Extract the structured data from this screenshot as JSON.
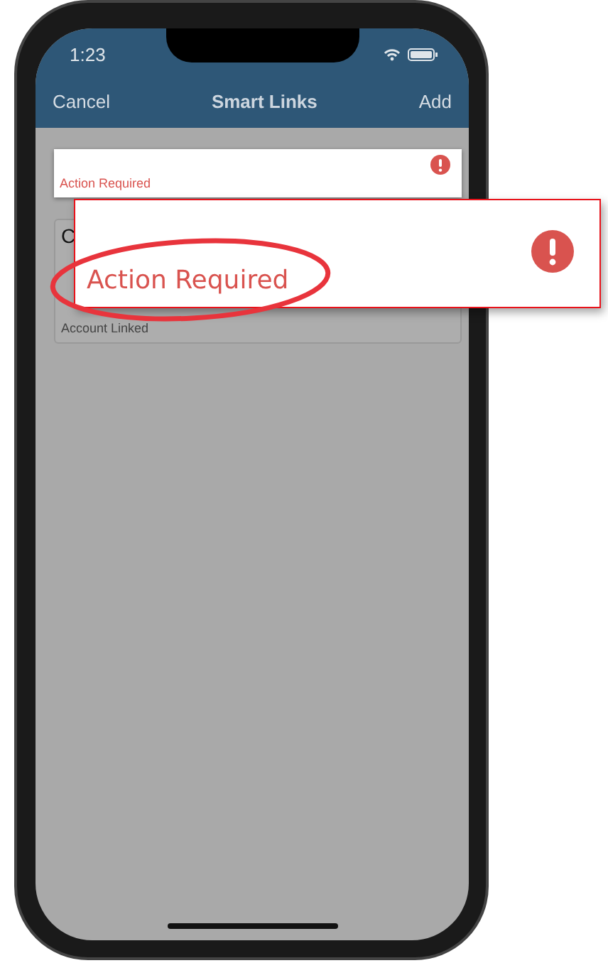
{
  "status_bar": {
    "time": "1:23"
  },
  "nav": {
    "left": "Cancel",
    "title": "Smart Links",
    "right": "Add"
  },
  "cards": [
    {
      "kind": "alert",
      "subtitle": "Action Required"
    },
    {
      "kind": "partial",
      "title": "C"
    },
    {
      "kind": "linked",
      "subtitle": "Account Linked"
    }
  ],
  "callout": {
    "text": "Action Required"
  }
}
